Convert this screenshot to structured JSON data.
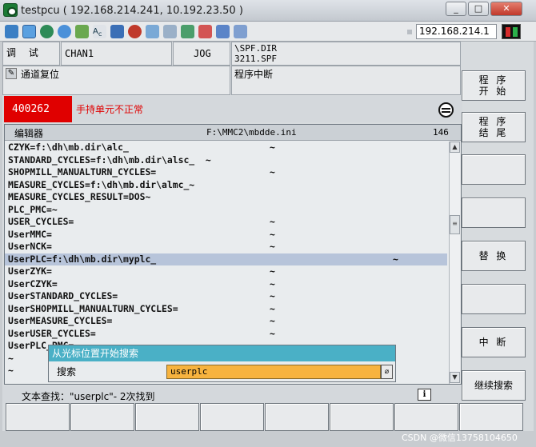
{
  "window": {
    "title": "testpcu ( 192.168.214.241, 10.192.23.50 )",
    "buttons": [
      "_",
      "□",
      "✕"
    ]
  },
  "toolbar": {
    "ip_address": "192.168.214.1",
    "icons": [
      "network-icon",
      "window-icon",
      "globe-icon",
      "refresh-icon",
      "transfer-icon",
      "text-abc-icon",
      "info-icon",
      "stop-icon",
      "settings-icon",
      "tools-icon",
      "copy-icon",
      "forward-icon",
      "reply-icon"
    ]
  },
  "header": {
    "mode": "调 试",
    "channel": "CHAN1",
    "op_mode": "JOG",
    "program_path_1": "\\SPF.DIR",
    "program_path_2": "3211.SPF",
    "reset_status": "通道复位",
    "program_status": "程序中断"
  },
  "alarm": {
    "number": "400262",
    "text": "手持单元不正常"
  },
  "editor": {
    "title": "编辑器",
    "file": "F:\\MMC2\\mbdde.ini",
    "line_count": "146",
    "lines": [
      {
        "text": "CZYK=f:\\dh\\mb.dir\\alc_",
        "tilde": "~"
      },
      {
        "text": "STANDARD_CYCLES=f:\\dh\\mb.dir\\alsc_  ~",
        "tilde": ""
      },
      {
        "text": "SHOPMILL_MANUALTURN_CYCLES=",
        "tilde": "~"
      },
      {
        "text": "MEASURE_CYCLES=f:\\dh\\mb.dir\\almc_~",
        "tilde": ""
      },
      {
        "text": "MEASURE_CYCLES_RESULT=DOS~",
        "tilde": ""
      },
      {
        "text": "PLC_PMC=~",
        "tilde": ""
      },
      {
        "text": "USER_CYCLES=",
        "tilde": "~"
      },
      {
        "text": "UserMMC=",
        "tilde": "~"
      },
      {
        "text": "UserNCK=",
        "tilde": "~"
      },
      {
        "text": "UserPLC=f:\\dh\\mb.dir\\myplc_",
        "tilde": "~",
        "selected": true
      },
      {
        "text": "UserZYK=",
        "tilde": "~"
      },
      {
        "text": "UserCZYK=",
        "tilde": "~"
      },
      {
        "text": "UserSTANDARD_CYCLES=",
        "tilde": "~"
      },
      {
        "text": "UserSHOPMILL_MANUALTURN_CYCLES=",
        "tilde": "~"
      },
      {
        "text": "UserMEASURE_CYCLES=",
        "tilde": "~"
      },
      {
        "text": "UserUSER_CYCLES=",
        "tilde": "~"
      },
      {
        "text": "UserPLC_PMC=~",
        "tilde": ""
      },
      {
        "text": "~",
        "tilde": ""
      },
      {
        "text": "~",
        "tilde": ""
      }
    ]
  },
  "search_dialog": {
    "title": "从光标位置开始搜索",
    "label": "搜索",
    "value": "userplc"
  },
  "status_line": {
    "text": "文本查找：\"userplc\"- 2次找到",
    "info_icon": "i"
  },
  "softkeys_vertical": [
    {
      "label": "程 序\n开 始"
    },
    {
      "label": "程 序\n结 尾"
    },
    {
      "label": ""
    },
    {
      "label": ""
    },
    {
      "label": "替 换"
    },
    {
      "label": ""
    },
    {
      "label": "中 断"
    },
    {
      "label": "继续搜索"
    }
  ],
  "watermark": "CSDN @微信13758104650"
}
